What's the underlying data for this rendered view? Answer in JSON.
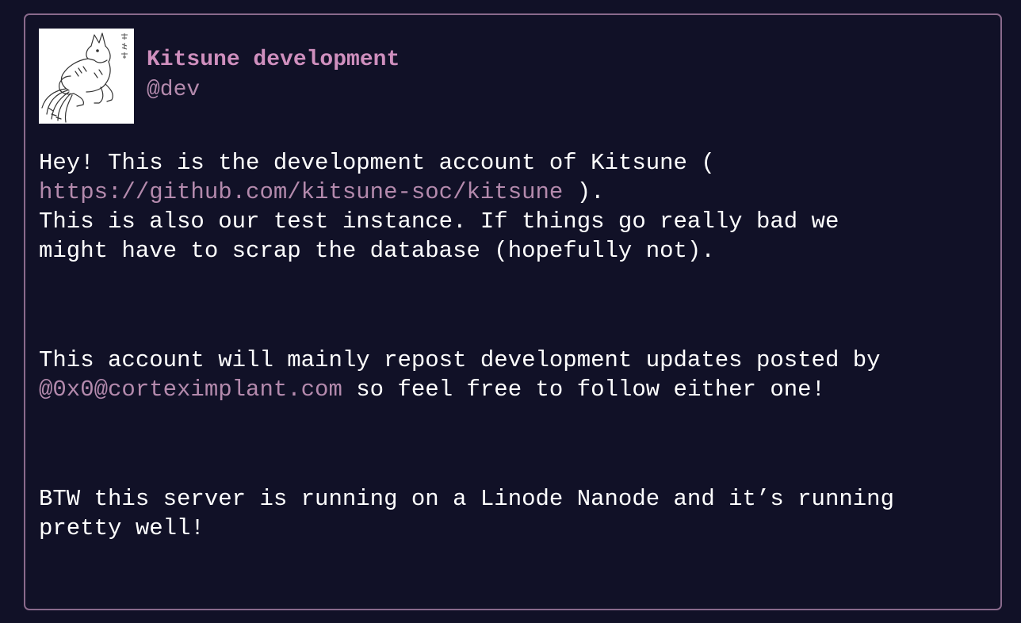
{
  "profile": {
    "display_name": "Kitsune development",
    "handle": "@dev",
    "avatar": "fox-drawing-avatar"
  },
  "bio": {
    "p1": {
      "l1a": "Hey! This is the development account of Kitsune (",
      "link": "https://github.com/kitsune-soc/kitsune",
      "l2b": " ).",
      "l3": "This is also our test instance. If things go really bad we",
      "l4": "might have to scrap the database (hopefully not)."
    },
    "p2": {
      "l1": "This account will mainly repost development updates posted by",
      "mention": "@0x0@corteximplant.com",
      "l2b": " so feel free to follow either one!"
    },
    "p3": {
      "l1": "BTW this server is running on a Linode Nanode and it’s running",
      "l2": "pretty well!"
    }
  },
  "colors": {
    "background": "#111127",
    "border": "#8a6a8c",
    "accent": "#cf8fbe",
    "link": "#b48aad",
    "text": "#ffffff"
  }
}
